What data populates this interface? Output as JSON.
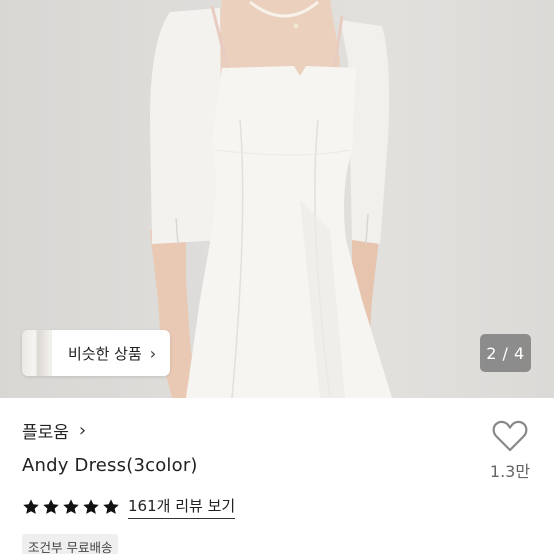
{
  "gallery": {
    "current_page": 2,
    "total_pages": 4,
    "page_label": "2 / 4",
    "similar_products_label": "비슷한 상품",
    "similar_products_chevron_icon": "chevron-right-icon"
  },
  "product": {
    "shop_name": "플로움",
    "shop_chevron_icon": "chevron-right-icon",
    "name": "Andy Dress(3color)",
    "like_icon": "heart-outline-icon",
    "like_count": "1.3만",
    "rating": 5,
    "rating_max": 5,
    "review_label": "161개 리뷰 보기",
    "shipping_badge": "조건부 무료배송"
  },
  "colors": {
    "photo_background": "#dedcd9",
    "star": "#111111",
    "heart_outline": "#888888",
    "badge_background": "#efefef"
  }
}
